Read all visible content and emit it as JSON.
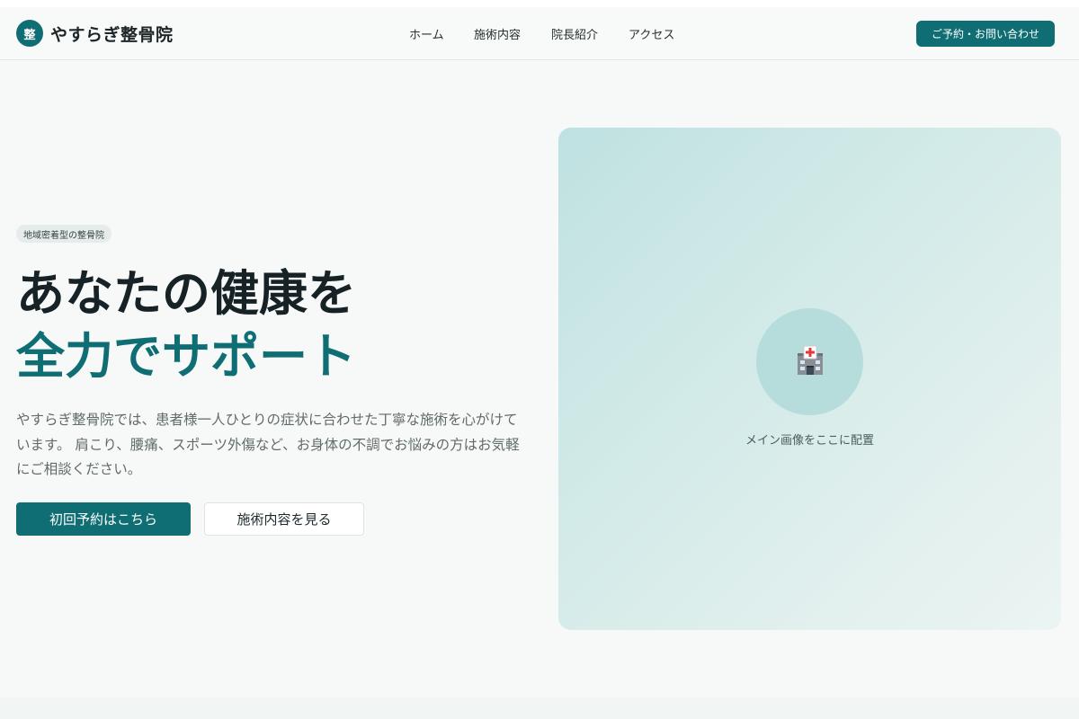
{
  "header": {
    "logo_badge": "整",
    "site_name": "やすらぎ整骨院",
    "nav": [
      "ホーム",
      "施術内容",
      "院長紹介",
      "アクセス"
    ],
    "cta_label": "ご予約・お問い合わせ"
  },
  "hero": {
    "tag": "地域密着型の整骨院",
    "headline_line1": "あなたの健康を",
    "headline_line2": "全力でサポート",
    "description": "やすらぎ整骨院では、患者様一人ひとりの症状に合わせた丁寧な施術を心がけています。 肩こり、腰痛、スポーツ外傷など、お身体の不調でお悩みの方はお気軽にご相談ください。",
    "primary_button": "初回予約はこちら",
    "secondary_button": "施術内容を見る"
  },
  "image_placeholder": {
    "icon": "hospital-icon",
    "caption": "メイン画像をここに配置"
  },
  "colors": {
    "accent": "#0f6e74",
    "background": "#f6f9f8",
    "text": "#172226"
  }
}
